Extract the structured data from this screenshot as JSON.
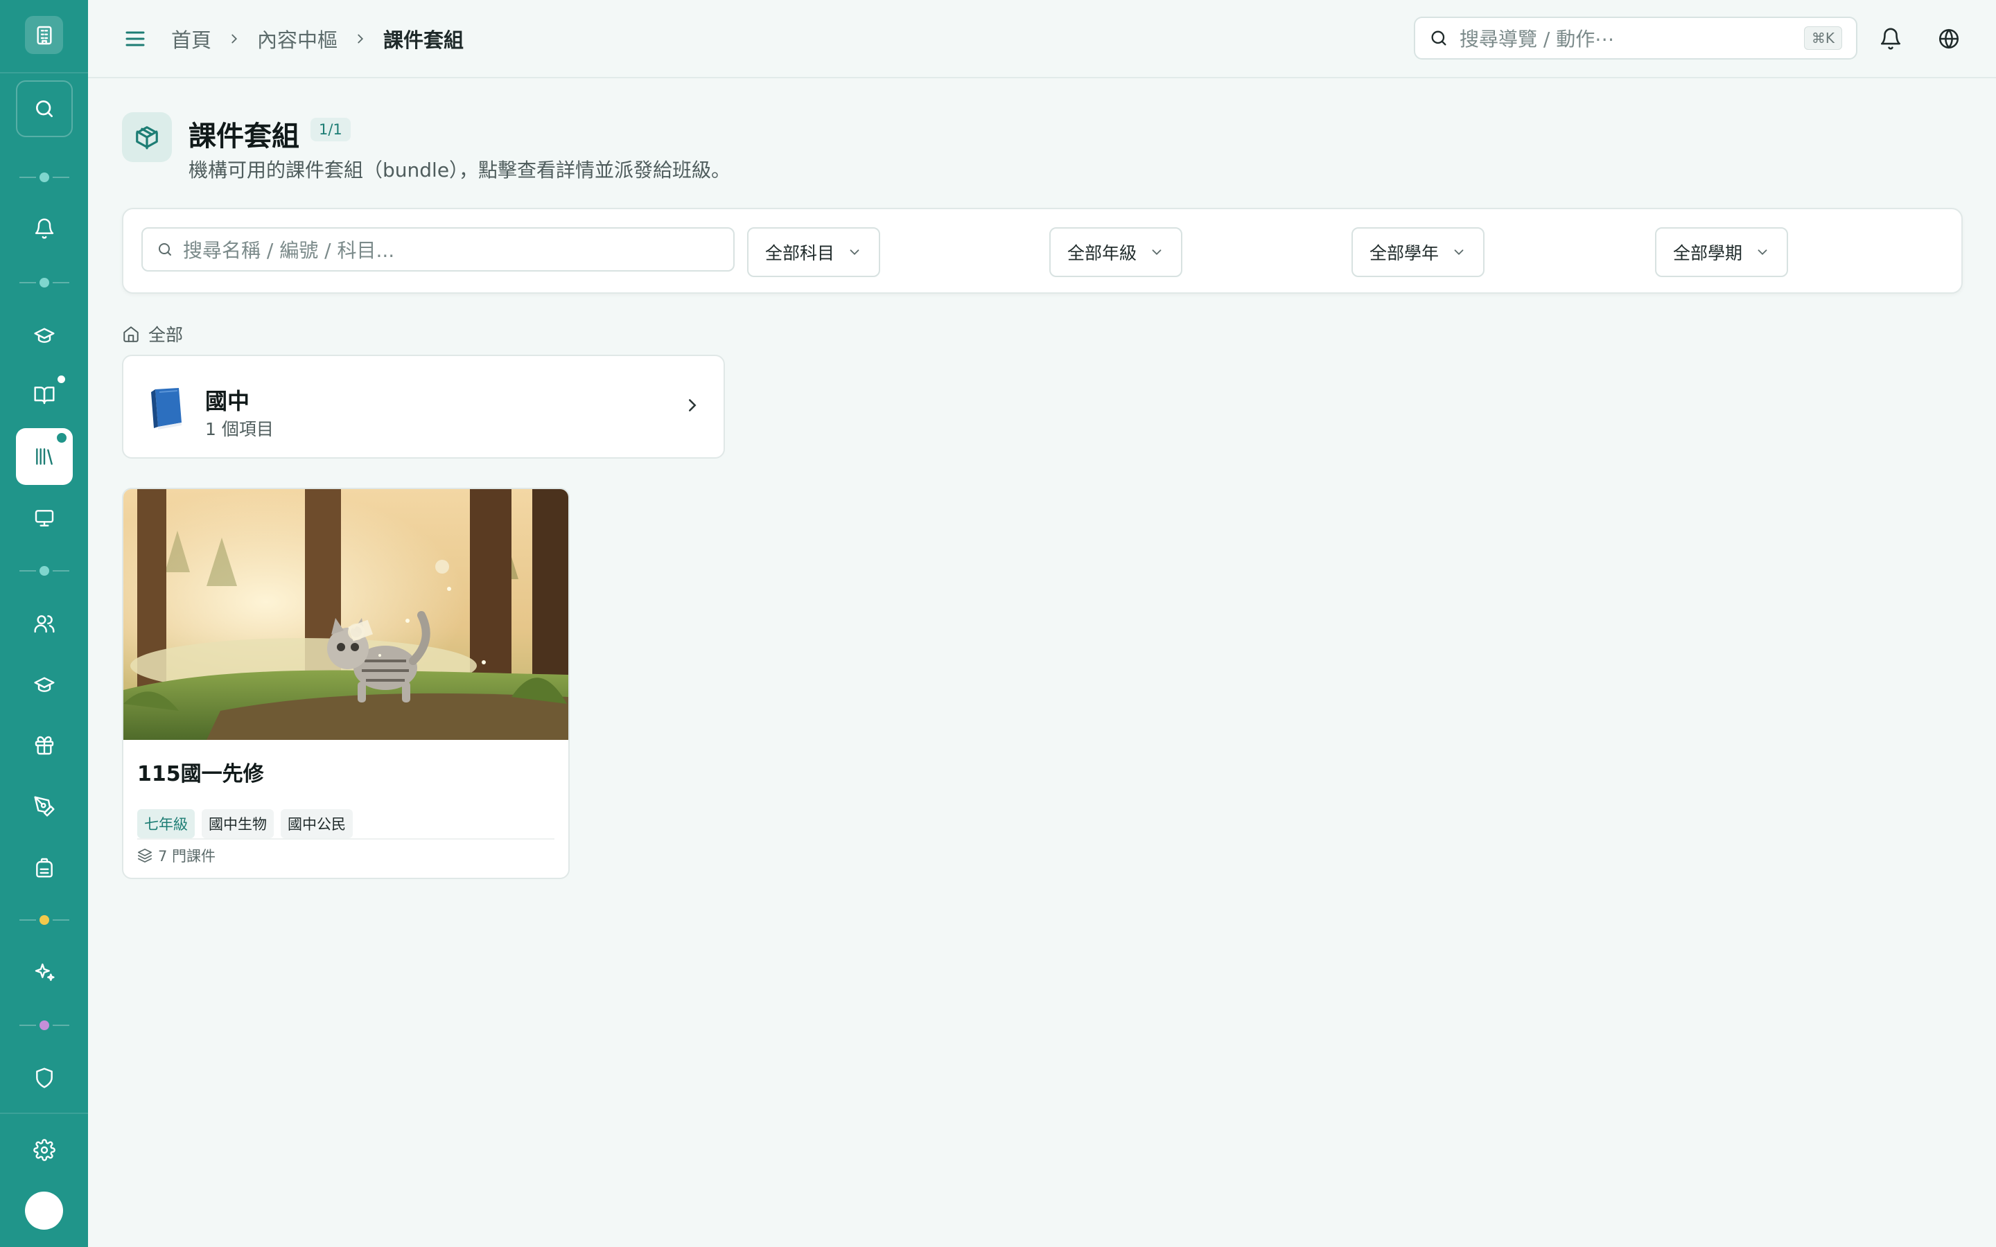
{
  "colors": {
    "sidebar_bg": "#20958a",
    "accent": "#1d7d74",
    "page_bg": "#f3f8f7"
  },
  "sidebar": {
    "logo_icon": "building-icon",
    "items": [
      {
        "icon": "search-icon"
      },
      {
        "icon": "bell-icon"
      },
      {
        "icon": "graduation-cap-icon"
      },
      {
        "icon": "book-open-icon",
        "badge": true
      },
      {
        "icon": "library-icon",
        "active": true,
        "badge": true
      },
      {
        "icon": "monitor-icon"
      },
      {
        "icon": "users-icon"
      },
      {
        "icon": "graduation-cap-icon"
      },
      {
        "icon": "gift-icon"
      },
      {
        "icon": "pen-tool-icon"
      },
      {
        "icon": "backpack-icon"
      },
      {
        "icon": "sparkles-icon"
      },
      {
        "icon": "shield-icon"
      },
      {
        "icon": "gear-icon"
      }
    ],
    "divider_dot_colors": [
      "#7fd6ce",
      "#7fd6ce",
      "#7fd6ce",
      "#f2c94c",
      "#c48fd9"
    ]
  },
  "topbar": {
    "breadcrumbs": [
      "首頁",
      "內容中樞",
      "課件套組"
    ],
    "search_placeholder": "搜尋導覽 / 動作⋯",
    "search_shortcut": "⌘K"
  },
  "header": {
    "title": "課件套組",
    "count": "1/1",
    "description": "機構可用的課件套組（bundle），點擊查看詳情並派發給班級。"
  },
  "filters": {
    "search_placeholder": "搜尋名稱 / 編號 / 科目...",
    "subject": "全部科目",
    "grade": "全部年級",
    "school_year": "全部學年",
    "semester": "全部學期"
  },
  "scope": {
    "label": "全部"
  },
  "folders": [
    {
      "name": "國中",
      "count_label": "1 個項目"
    }
  ],
  "bundles": [
    {
      "title": "115國一先修",
      "tags": [
        "七年級",
        "國中生物",
        "國中公民"
      ],
      "courses_label": "7 門課件"
    }
  ]
}
